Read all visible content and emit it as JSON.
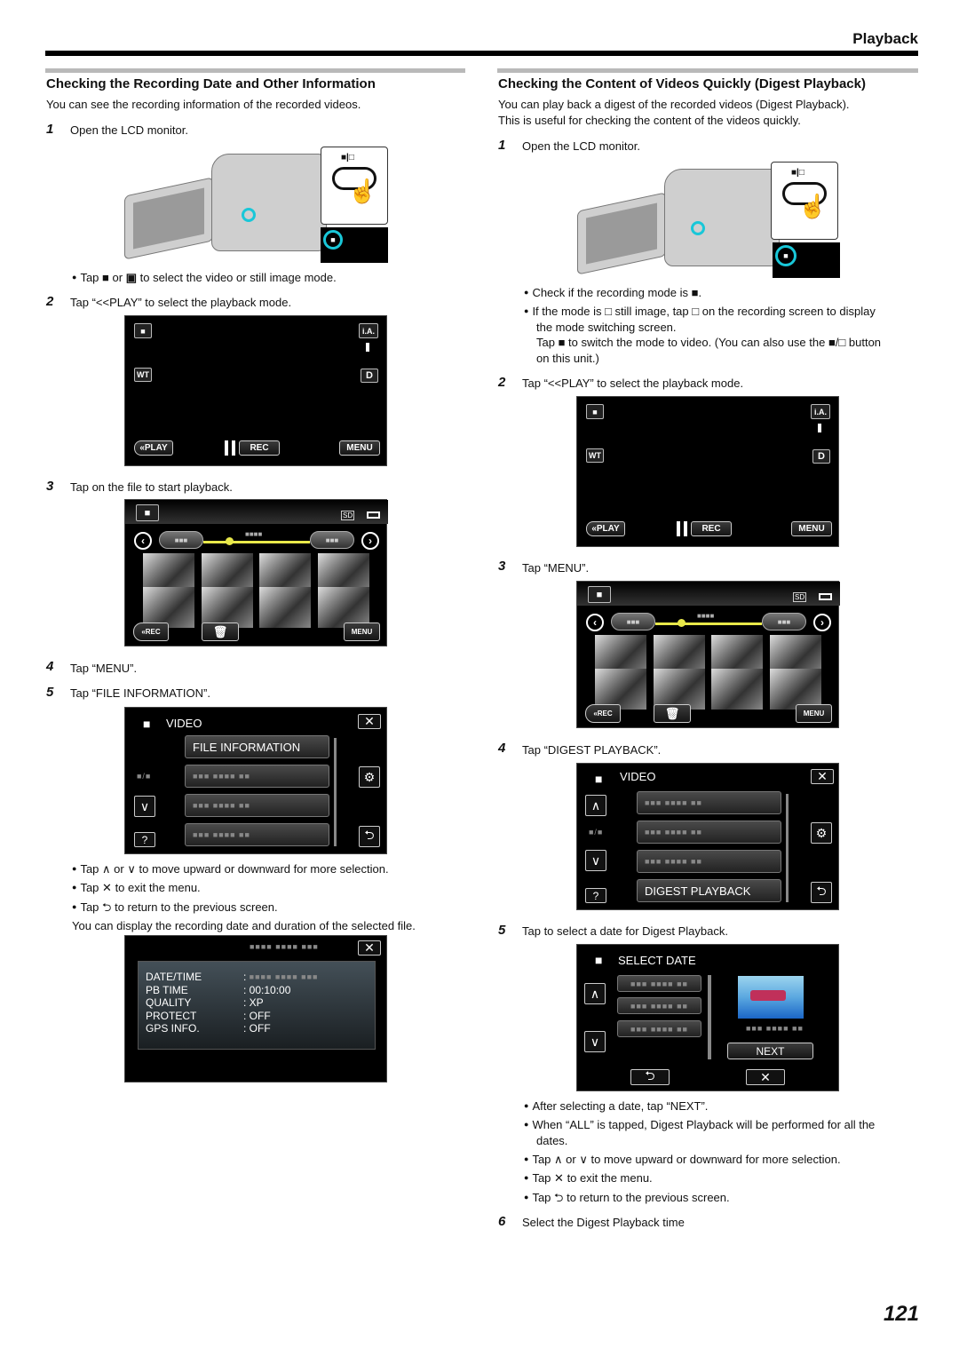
{
  "header": {
    "section": "Playback"
  },
  "left": {
    "title": "Checking the Recording Date and Other Information",
    "intro": "You can see the recording information of the recorded videos.",
    "step1": {
      "num": "1",
      "text": "Open the LCD monitor."
    },
    "bullet1": "Tap ■ or □ to select the video or still image mode.",
    "bullet1_parts": {
      "pre": "Tap",
      "mid": "or",
      "post": "to select the video or still image mode."
    },
    "step2": {
      "num": "2",
      "text": "Tap “<<PLAY” to select the playback mode."
    },
    "rec_screen": {
      "ia": "i.A.",
      "wt": "WT",
      "d": "D",
      "play": "«PLAY",
      "rec": "REC",
      "menu": "MENU"
    },
    "step3": {
      "num": "3",
      "text": "Tap on the file to start playback."
    },
    "index_screen": {
      "sd": "SD",
      "rec": "«REC",
      "menu": "MENU"
    },
    "step4": {
      "num": "4",
      "text": "Tap “MENU”."
    },
    "step5": {
      "num": "5",
      "text": "Tap “FILE INFORMATION”."
    },
    "menu_screen": {
      "title": "VIDEO",
      "items": [
        "FILE INFORMATION",
        "■■■ ■■■■ ■■",
        "■■■ ■■■■ ■■",
        "■■■ ■■■■ ■■"
      ],
      "page": "■/■",
      "help": "?"
    },
    "bullets2": [
      {
        "pre": "Tap",
        "icon1": "∧",
        "mid": "or",
        "icon2": "∨",
        "post": "to move upward or downward for more selection."
      },
      {
        "pre": "Tap",
        "icon1": "✕",
        "post": "to exit the menu."
      },
      {
        "pre": "Tap",
        "icon1": "⮌",
        "post": "to return to the previous screen."
      }
    ],
    "outro": "You can display the recording date and duration of the selected file.",
    "info_screen": {
      "header_blur": "■■■■ ■■■■ ■■■",
      "rows": [
        {
          "label": "DATE/TIME",
          "value": "■■■■ ■■■■ ■■■"
        },
        {
          "label": "PB TIME",
          "value": "00:10:00"
        },
        {
          "label": "QUALITY",
          "value": "XP"
        },
        {
          "label": "PROTECT",
          "value": "OFF"
        },
        {
          "label": "GPS INFO.",
          "value": "OFF"
        }
      ]
    }
  },
  "right": {
    "title": "Checking the Content of Videos Quickly (Digest Playback)",
    "intro1": "You can play back a digest of the recorded videos (Digest Playback).",
    "intro2": "This is useful for checking the content of the videos quickly.",
    "step1": {
      "num": "1",
      "text": "Open the LCD monitor."
    },
    "bullets1": [
      "Check if the recording mode is ■.",
      "If the mode is □ still image, tap □ on the recording screen to display",
      "the mode switching screen.",
      "Tap ■ to switch the mode to video. (You can also use the ■/□ button",
      "on this unit.)"
    ],
    "step2": {
      "num": "2",
      "text": "Tap “<<PLAY” to select the playback mode."
    },
    "rec_screen": {
      "ia": "i.A.",
      "wt": "WT",
      "d": "D",
      "play": "«PLAY",
      "rec": "REC",
      "menu": "MENU"
    },
    "step3": {
      "num": "3",
      "text": "Tap “MENU”."
    },
    "index_screen": {
      "sd": "SD",
      "rec": "«REC",
      "menu": "MENU"
    },
    "step4": {
      "num": "4",
      "text": "Tap “DIGEST PLAYBACK”."
    },
    "menu_screen": {
      "title": "VIDEO",
      "items": [
        "■■■ ■■■■ ■■",
        "■■■ ■■■■ ■■",
        "■■■ ■■■■ ■■",
        "DIGEST PLAYBACK"
      ],
      "page": "■/■",
      "help": "?"
    },
    "step5": {
      "num": "5",
      "text": "Tap to select a date for Digest Playback."
    },
    "date_screen": {
      "title": "SELECT DATE",
      "dates": [
        "■■■ ■■■■ ■■",
        "■■■ ■■■■ ■■",
        "■■■ ■■■■ ■■"
      ],
      "preview_caption": "■■■ ■■■■ ■■",
      "next": "NEXT"
    },
    "bullets2": [
      {
        "pre": "After selecting a date, tap “NEXT”."
      },
      {
        "pre": "When “ALL” is tapped, Digest Playback will be performed for all the"
      },
      {
        "pre": "dates."
      },
      {
        "pre": "Tap",
        "icon1": "∧",
        "mid": "or",
        "icon2": "∨",
        "post": "to move upward or downward for more selection."
      },
      {
        "pre": "Tap",
        "icon1": "✕",
        "post": "to exit the menu."
      },
      {
        "pre": "Tap",
        "icon1": "⮌",
        "post": "to return to the previous screen."
      }
    ],
    "step6": {
      "num": "6",
      "text": "Select the Digest Playback time"
    }
  },
  "page_number": "121"
}
